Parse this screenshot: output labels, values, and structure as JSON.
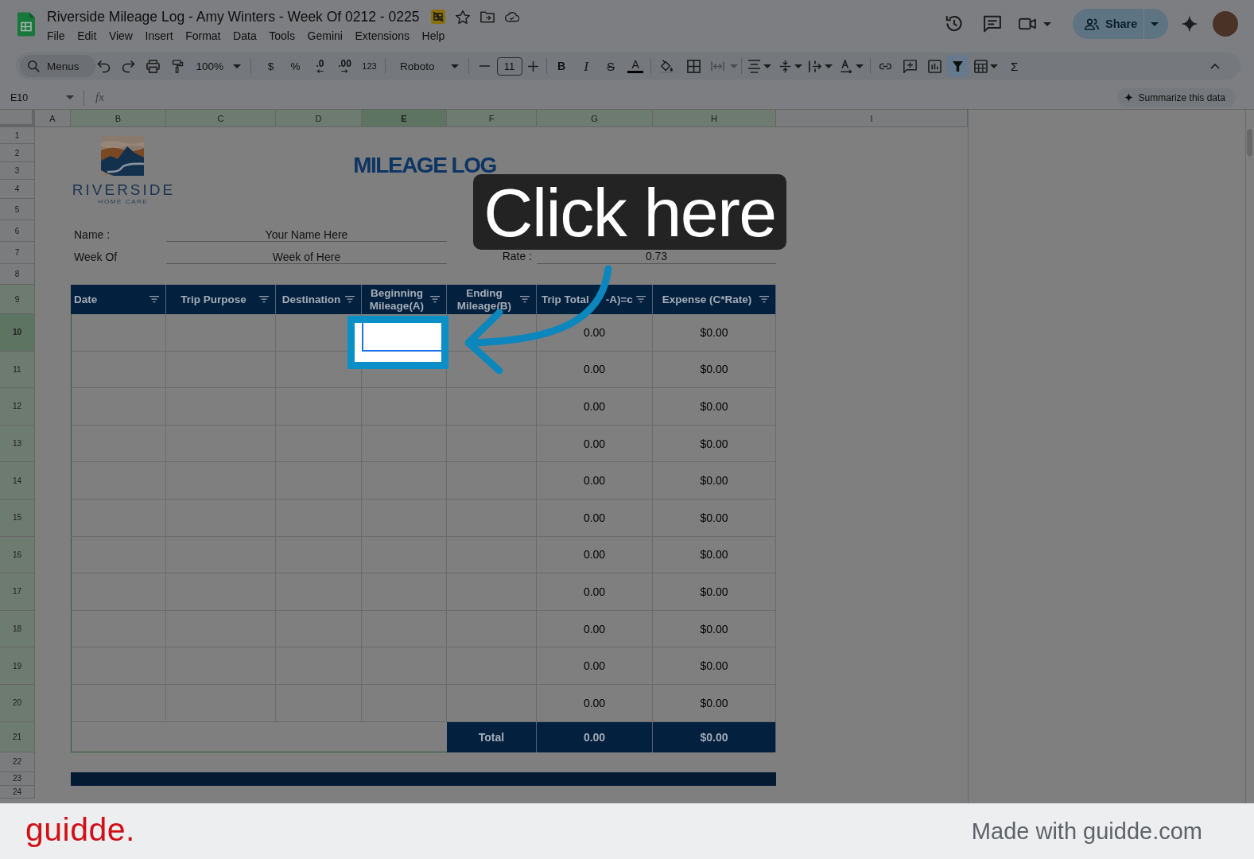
{
  "app": {
    "title": "Riverside Mileage Log - Amy Winters - Week Of 0212 - 0225",
    "menu": [
      "File",
      "Edit",
      "View",
      "Insert",
      "Format",
      "Data",
      "Tools",
      "Gemini",
      "Extensions",
      "Help"
    ],
    "share": "Share"
  },
  "toolbar": {
    "search": "Menus",
    "zoom": "100%",
    "currency": "$",
    "percent": "%",
    "decrease_decimals": ".0",
    "increase_decimals": ".00",
    "number_format": "123",
    "font": "Roboto",
    "font_size": "11",
    "bold": "B",
    "italic": "I",
    "strikethrough": "S",
    "text_color": "A",
    "functions": "Σ",
    "merge_disabled": true,
    "filter_on": true
  },
  "formula_bar": {
    "cell_ref": "E10",
    "fx": "fx",
    "summarize": "Summarize this data"
  },
  "grid": {
    "columns": [
      {
        "label": "A",
        "selected": false,
        "in_range": false
      },
      {
        "label": "B",
        "selected": false,
        "in_range": true
      },
      {
        "label": "C",
        "selected": false,
        "in_range": true
      },
      {
        "label": "D",
        "selected": false,
        "in_range": true
      },
      {
        "label": "E",
        "selected": true,
        "in_range": true
      },
      {
        "label": "F",
        "selected": false,
        "in_range": true
      },
      {
        "label": "G",
        "selected": false,
        "in_range": true
      },
      {
        "label": "H",
        "selected": false,
        "in_range": true
      },
      {
        "label": "I",
        "selected": false,
        "in_range": false
      }
    ],
    "rows": [
      {
        "label": "1",
        "selected": false,
        "in_range": false
      },
      {
        "label": "2",
        "selected": false,
        "in_range": false
      },
      {
        "label": "3",
        "selected": false,
        "in_range": false
      },
      {
        "label": "4",
        "selected": false,
        "in_range": false
      },
      {
        "label": "5",
        "selected": false,
        "in_range": false
      },
      {
        "label": "6",
        "selected": false,
        "in_range": false
      },
      {
        "label": "7",
        "selected": false,
        "in_range": false
      },
      {
        "label": "8",
        "selected": false,
        "in_range": false
      },
      {
        "label": "9",
        "selected": false,
        "in_range": true
      },
      {
        "label": "10",
        "selected": true,
        "in_range": true
      },
      {
        "label": "11",
        "selected": false,
        "in_range": true
      },
      {
        "label": "12",
        "selected": false,
        "in_range": true
      },
      {
        "label": "13",
        "selected": false,
        "in_range": true
      },
      {
        "label": "14",
        "selected": false,
        "in_range": true
      },
      {
        "label": "15",
        "selected": false,
        "in_range": true
      },
      {
        "label": "16",
        "selected": false,
        "in_range": true
      },
      {
        "label": "17",
        "selected": false,
        "in_range": true
      },
      {
        "label": "18",
        "selected": false,
        "in_range": true
      },
      {
        "label": "19",
        "selected": false,
        "in_range": true
      },
      {
        "label": "20",
        "selected": false,
        "in_range": true
      },
      {
        "label": "21",
        "selected": false,
        "in_range": true
      },
      {
        "label": "22",
        "selected": false,
        "in_range": false
      },
      {
        "label": "23",
        "selected": false,
        "in_range": false
      },
      {
        "label": "24",
        "selected": false,
        "in_range": false
      }
    ]
  },
  "sheet": {
    "logo": {
      "name": "RIVERSIDE",
      "tagline": "HOME CARE"
    },
    "title": "MILEAGE LOG",
    "fields": [
      {
        "label": "Name :",
        "value": "Your Name Here"
      },
      {
        "label": "Week Of",
        "value": "Week of Here"
      }
    ],
    "rate": {
      "label": "Rate :",
      "value": "0.73"
    },
    "table": {
      "columns": [
        {
          "label": "Date"
        },
        {
          "label": "Trip Purpose"
        },
        {
          "label": "Destination"
        },
        {
          "label": "Beginning Mileage(A)"
        },
        {
          "label": "Ending Mileage(B)"
        },
        {
          "label": "Trip Total",
          "label_end": "-A)=c"
        },
        {
          "label": "Expense (C*Rate)"
        }
      ],
      "rows": [
        {
          "trip_total": "0.00",
          "expense": "$0.00"
        },
        {
          "trip_total": "0.00",
          "expense": "$0.00"
        },
        {
          "trip_total": "0.00",
          "expense": "$0.00"
        },
        {
          "trip_total": "0.00",
          "expense": "$0.00"
        },
        {
          "trip_total": "0.00",
          "expense": "$0.00"
        },
        {
          "trip_total": "0.00",
          "expense": "$0.00"
        },
        {
          "trip_total": "0.00",
          "expense": "$0.00"
        },
        {
          "trip_total": "0.00",
          "expense": "$0.00"
        },
        {
          "trip_total": "0.00",
          "expense": "$0.00"
        },
        {
          "trip_total": "0.00",
          "expense": "$0.00"
        },
        {
          "trip_total": "0.00",
          "expense": "$0.00"
        }
      ],
      "total": {
        "label": "Total",
        "trip_total": "0.00",
        "expense": "$0.00"
      }
    }
  },
  "callout": {
    "text": "Click here"
  },
  "footer": {
    "brand": "guidde.",
    "credit": "Made with guidde.com"
  }
}
